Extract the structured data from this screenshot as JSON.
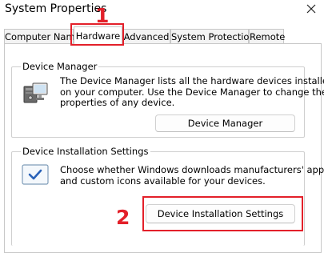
{
  "window": {
    "title": "System Properties",
    "close_icon": "close-icon"
  },
  "tabs": [
    {
      "label": "Computer Name",
      "selected": false
    },
    {
      "label": "Hardware",
      "selected": true
    },
    {
      "label": "Advanced",
      "selected": false
    },
    {
      "label": "System Protection",
      "selected": false
    },
    {
      "label": "Remote",
      "selected": false
    }
  ],
  "device_manager": {
    "group_label": "Device Manager",
    "description_lines": [
      "The Device Manager lists all the hardware devices installed",
      "on your computer. Use the Device Manager to change the",
      "properties of any device."
    ],
    "button_label": "Device Manager",
    "icon": "device-manager-icon"
  },
  "device_installation": {
    "group_label": "Device Installation Settings",
    "description_lines": [
      "Choose whether Windows downloads manufacturers' apps",
      "and custom icons available for your devices."
    ],
    "button_label": "Device Installation Settings",
    "icon": "checkbox-check-icon"
  },
  "annotations": {
    "step1": "1",
    "step2": "2",
    "color": "#e3202a"
  }
}
